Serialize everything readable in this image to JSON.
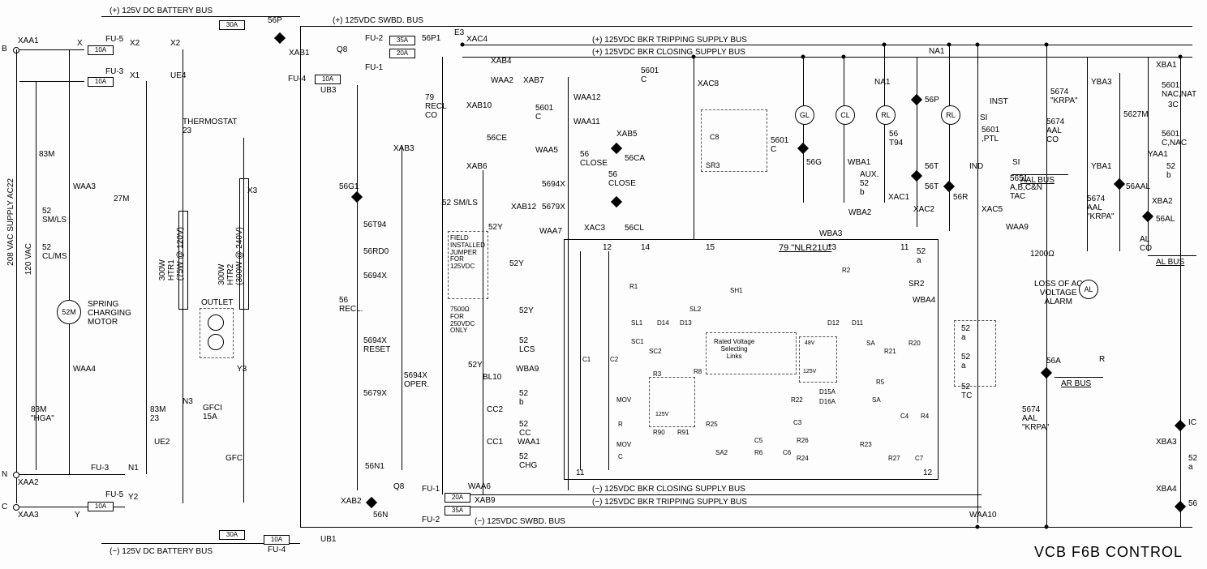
{
  "title": "VCB F6B CONTROL",
  "buses": {
    "dc_battery_pos": "(+) 125V DC BATTERY BUS",
    "dc_battery_neg": "(−) 125V DC BATTERY BUS",
    "swbd_pos": "(+) 125VDC SWBD. BUS",
    "swbd_neg": "(−) 125VDC SWBD. BUS",
    "trip_pos": "(+) 125VDC BKR TRIPPING SUPPLY BUS",
    "trip_neg": "(−) 125VDC BKR TRIPPING SUPPLY BUS",
    "close_pos": "(+) 125VDC BKR CLOSING SUPPLY BUS",
    "close_neg": "(−) 125VDC BKR CLOSING SUPPLY BUS",
    "aal_bus": "AAL BUS",
    "al_bus": "AL BUS",
    "ar_bus": "AR BUS"
  },
  "left": {
    "xaa1": "XAA1",
    "xaa2": "XAA2",
    "xaa3": "XAA3",
    "b": "B",
    "n": "N",
    "c": "C",
    "supply208": "208 VAC SUPPLY AC22",
    "supply120": "120 VAC",
    "fu5_top": "FU-5",
    "fu5_top_rating": "10A",
    "fu3_top": "FU-3",
    "fu3_top_rating": "10A",
    "fu3_bot": "FU-3",
    "fu5_bot": "FU-5",
    "fu5_bot_rating": "10A",
    "x": "X",
    "x1": "X1",
    "x2a": "X2",
    "x2b": "X2",
    "ue4": "UE4",
    "waa3": "WAA3",
    "m83": "83M",
    "m27": "27M",
    "sw52smls": "52\nSM/LS",
    "sw52clms": "52\nCL/MS",
    "motor52m": "52M",
    "motor_label": "SPRING\nCHARGING\nMOTOR",
    "waa4": "WAA4",
    "hga": "83M\n\"HGA\"",
    "ue2": "UE2",
    "n1": "N1",
    "n3": "N3",
    "y": "Y",
    "y2": "Y2",
    "y3": "Y3",
    "thermostat": "THERMOSTAT\n23",
    "htr1": "300W\nHTR1\n(75W @ 120V)",
    "htr2": "300W\nHTR2\n(300W @ 240V)",
    "outlet": "OUTLET",
    "gfci": "GFCI\n15A",
    "gfci2": "GFCI",
    "x3": "X3",
    "m83b": "83M\n23"
  },
  "mid_left": {
    "fuse30a": "30A",
    "fuse30b": "30A",
    "fu2": "FU-2",
    "fu2r": "35A",
    "fu1": "FU-1",
    "fu1r": "20A",
    "fu4": "FU-4",
    "fu4r": "10A",
    "ub1": "UB1",
    "ub3": "UB3",
    "p56": "56P",
    "p56p1": "56P1",
    "q8": "Q8",
    "xab1": "XAB1",
    "xab2": "XAB2",
    "n56": "56N",
    "n56a": "56N1",
    "e3": "E3"
  },
  "center": {
    "recl79": "79\nRECL\nCO",
    "g56": "56G1",
    "t56": "56T94",
    "rd56": "56RD0",
    "x5694": "5694X",
    "recl56": "56\nRECL.",
    "reset5694x": "5694X\nRESET",
    "oper5694x": "5694X\nOPER.",
    "x5679": "5679X",
    "xab3": "XAB3",
    "xab4": "XAB4",
    "xab6": "XAB6",
    "xab7": "XAB7",
    "xab9": "XAB9",
    "xab10": "XAB10",
    "xab12": "XAB12",
    "waa2": "WAA2",
    "waa5": "WAA5",
    "waa6": "WAA6",
    "waa7": "WAA7",
    "waa1": "WAA1",
    "waa11": "WAA11",
    "waa12": "WAA12",
    "ce56": "56CE",
    "c5601": "5601\nC",
    "smls52": "52 SM/LS",
    "y52": "52Y",
    "jumper": "FIELD\nINSTALLED\nJUMPER\nFOR\n125VDC",
    "r7500": "7500Ω\nFOR\n250VDC\nONLY",
    "lcs52": "52\nLCS",
    "b52": "52\nb",
    "cc52": "52\nCC",
    "chg52": "52\nCHG",
    "bl10": "BL10",
    "wba9": "WBA9",
    "cc1": "CC1",
    "cc2": "CC2",
    "close56": "56\nCLOSE",
    "close56b": "56\nCLOSE",
    "x5694b": "5694X",
    "x5679b": "5679X",
    "ca56": "56CA",
    "cl56": "56CL",
    "xab5": "XAB5",
    "xac3": "XAC3",
    "xac4": "XAC4"
  },
  "nlr": {
    "title": "79 \"NLR21U\"",
    "rvsl": "Rated Voltage\nSelecting\nLinks",
    "mov": "MOV",
    "mov2": "MOV",
    "c": "C",
    "r": "R",
    "sl1": "SL1",
    "sl2": "SL2",
    "sh1": "SH1",
    "d14": "D14",
    "d13": "D13",
    "d12": "D12",
    "d11": "D11",
    "r1": "R1",
    "r2": "R2",
    "r3": "R3",
    "r4": "R4",
    "r5": "R5",
    "r6": "R6",
    "r8": "R8",
    "r20": "R20",
    "r21": "R21",
    "r22": "R22",
    "r23": "R23",
    "r24": "R24",
    "r25": "R25",
    "r26": "R26",
    "r27": "R27",
    "c1": "C1",
    "c2": "C2",
    "c3": "C3",
    "c4": "C4",
    "c5": "C5",
    "c6": "C6",
    "c7": "C7",
    "sc1": "SC1",
    "sc2": "SC2",
    "sa": "SA",
    "sa2": "SA2",
    "v48": "48V",
    "v125": "125V",
    "r90": "R90",
    "r91": "R91",
    "d15a": "D15A",
    "d16a": "D16A",
    "pins": {
      "11": "11",
      "12": "12",
      "13": "13",
      "14": "14",
      "15": "15"
    }
  },
  "right_center": {
    "xac8": "XAC8",
    "xac1": "XAC1",
    "xac2": "XAC2",
    "xac5": "XAC5",
    "na1": "NA1",
    "na1b": "NA1",
    "c8": "C8",
    "sr3": "SR3",
    "sr2": "SR2",
    "c5601b": "5601\nC",
    "wba1": "WBA1",
    "wba2": "WBA2",
    "wba3": "WBA3",
    "wba4": "WBA4",
    "gl": "GL",
    "cl": "CL",
    "rl": "RL",
    "rl2": "RL",
    "g56l": "56G",
    "t56l": "56T",
    "t56b": "56T",
    "p56r": "56P",
    "t56194": "56\nT94",
    "aux52b": "AUX.\n52\nb",
    "r56": "56R",
    "a52": "52\na",
    "a52b": "52\na",
    "a52c": "52\na",
    "tc52": "52\nTC",
    "inst": "INST",
    "si": "SI",
    "ind": "IND",
    "ptl5601": "5601\n,PTL",
    "tac5651": "5651\nA,B,C&N\nTAC",
    "waa9": "WAA9",
    "waa10": "WAA10"
  },
  "right": {
    "krpa5674": "5674\n\"KRPA\"",
    "aal5674": "5674\nAAL\nCO",
    "aal5674b": "5674\nAAL\n\"KRPA\"",
    "aal5674c": "5674\nAAL\n\"KRPA\"",
    "m5627": "5627M",
    "nac5601": "5601\nNAC,NAT",
    "cnac5601": "5601\nC,NAC",
    "b52r": "52\nb",
    "yaa1": "YAA1",
    "yba1": "YBA1",
    "yba3": "YBA3",
    "aal56": "56AAL",
    "al56": "56AL",
    "alco": "AL\nCO",
    "xba1": "XBA1",
    "xba2": "XBA2",
    "xba3": "XBA3",
    "xba4": "XBA4",
    "r1200": "1200Ω",
    "loss_ac": "LOSS OF AC\nVOLTAGE\nALARM",
    "al_lamp": "AL",
    "a56": "56A",
    "r_term": "R",
    "ic": "IC",
    "a52r": "52\na",
    "n56r": "56",
    "c5601r": "5601\nC,NAC",
    "tc3": "3C"
  }
}
